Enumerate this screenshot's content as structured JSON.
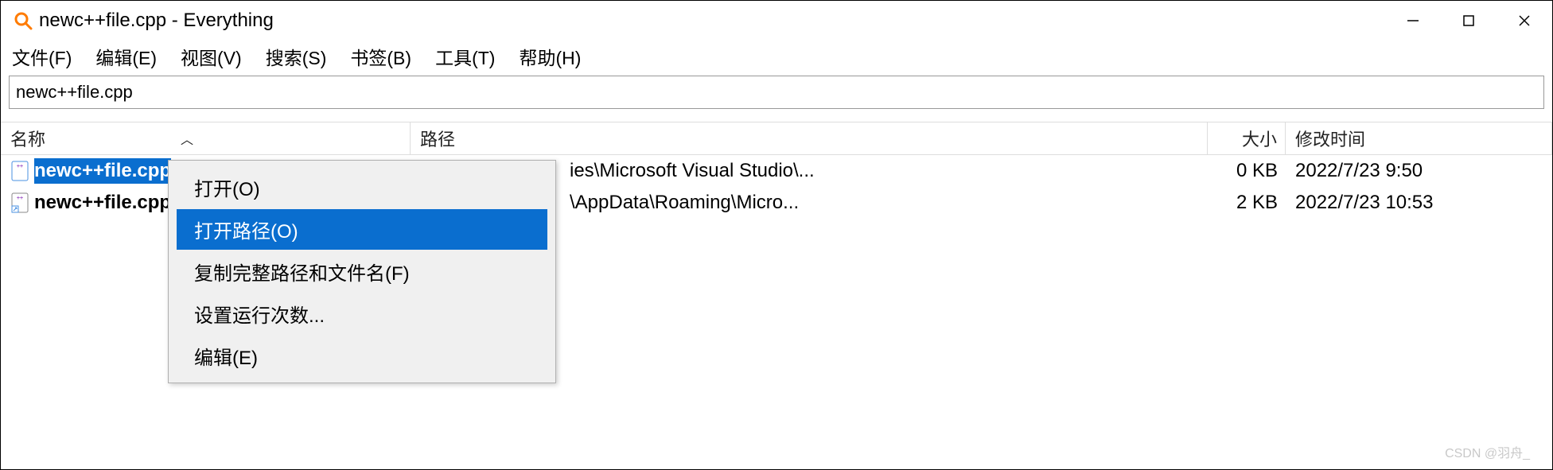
{
  "window": {
    "title": "newc++file.cpp - Everything"
  },
  "menu": {
    "file": "文件(F)",
    "edit": "编辑(E)",
    "view": "视图(V)",
    "search": "搜索(S)",
    "bookmarks": "书签(B)",
    "tools": "工具(T)",
    "help": "帮助(H)"
  },
  "search": {
    "value": "newc++file.cpp"
  },
  "columns": {
    "name": "名称",
    "path": "路径",
    "size": "大小",
    "modified": "修改时间"
  },
  "rows": [
    {
      "name": "newc++file.cpp",
      "path": "ies\\Microsoft Visual Studio\\...",
      "size": "0 KB",
      "modified": "2022/7/23 9:50",
      "selected": true
    },
    {
      "name": "newc++file.cpp",
      "path": "\\AppData\\Roaming\\Micro...",
      "size": "2 KB",
      "modified": "2022/7/23 10:53",
      "selected": false
    }
  ],
  "context_menu": {
    "open": "打开(O)",
    "open_path": "打开路径(O)",
    "copy_full_path": "复制完整路径和文件名(F)",
    "set_run_count": "设置运行次数...",
    "edit": "编辑(E)"
  },
  "watermark": "CSDN @羽舟_"
}
